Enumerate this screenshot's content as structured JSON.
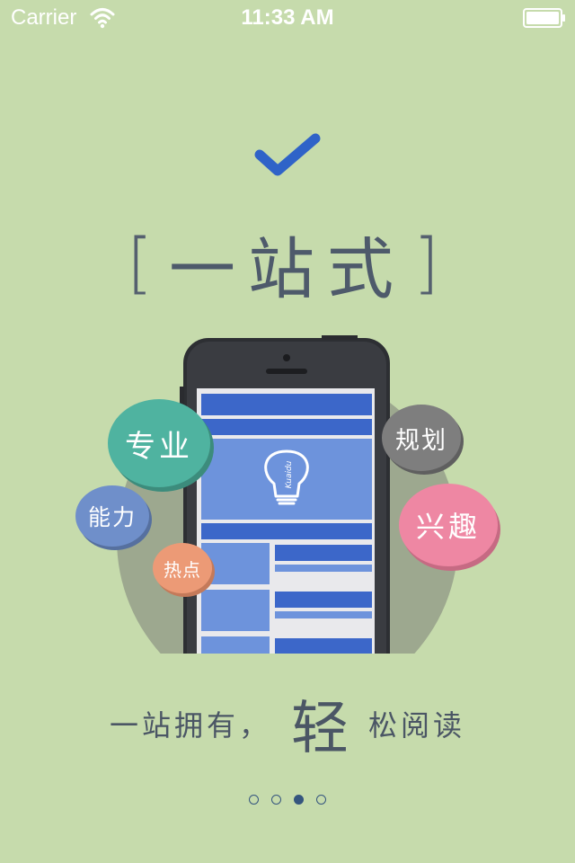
{
  "status_bar": {
    "carrier": "Carrier",
    "time": "11:33 AM",
    "icons": [
      "wifi-icon",
      "battery-icon"
    ]
  },
  "heading": {
    "bracket_left": "[",
    "title": "一站式",
    "bracket_right": "]",
    "icon": "checkmark-icon"
  },
  "bubbles": {
    "zhuanye": "专业",
    "guihua": "规划",
    "nengli": "能力",
    "xingqu": "兴趣",
    "redian": "热点"
  },
  "phone": {
    "icon": "lightbulb-icon",
    "bulb_text": "Kuaidu"
  },
  "slogan": {
    "part1": "一站拥有，",
    "emphasis": "轻",
    "part2": "松阅读"
  },
  "pager": {
    "count": 4,
    "active_index": 2
  },
  "colors": {
    "background": "#c6dbac",
    "accent_blue": "#2f63c8",
    "text_dark": "#4b5665"
  }
}
